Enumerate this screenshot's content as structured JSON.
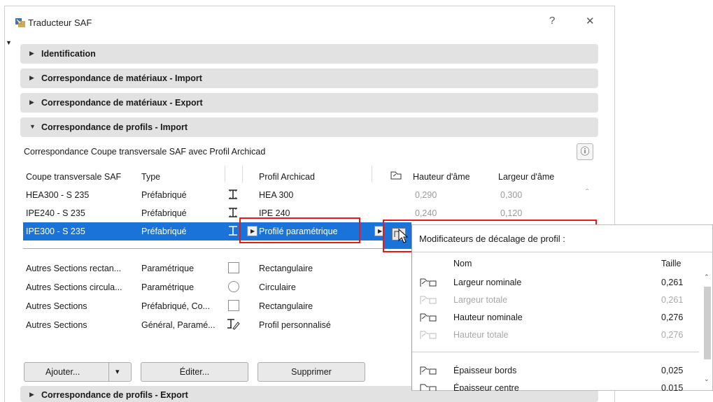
{
  "window": {
    "title": "Traducteur SAF",
    "help": "?",
    "close": "✕"
  },
  "sections": {
    "identification": "Identification",
    "mat_import": "Correspondance de matériaux - Import",
    "mat_export": "Correspondance de matériaux - Export",
    "prof_import": "Correspondance de profils - Import",
    "prof_export": "Correspondance de profils - Export"
  },
  "profile_import": {
    "caption": "Correspondance Coupe transversale SAF avec Profil Archicad",
    "info_icon": "ⓘ",
    "headers": {
      "saf": "Coupe transversale SAF",
      "type": "Type",
      "archicad": "Profil Archicad",
      "web_height": "Hauteur d'âme",
      "web_width": "Largeur d'âme"
    },
    "rows": [
      {
        "saf": "HEA300 - S 235",
        "type": "Préfabriqué",
        "icon": "i-beam-icon",
        "profile": "HEA 300",
        "height": "0,290",
        "width": "0,300"
      },
      {
        "saf": "IPE240 - S 235",
        "type": "Préfabriqué",
        "icon": "i-beam-icon",
        "profile": "IPE 240",
        "height": "0,240",
        "width": "0,120"
      },
      {
        "saf": "IPE300 - S 235",
        "type": "Préfabriqué",
        "icon": "i-beam-icon",
        "profile": "Profilé paramétrique",
        "height": "",
        "width": ""
      }
    ],
    "other_rows": [
      {
        "saf": "Autres Sections rectan...",
        "type": "Paramétrique",
        "icon": "square-icon",
        "profile": "Rectangulaire"
      },
      {
        "saf": "Autres Sections circula...",
        "type": "Paramétrique",
        "icon": "circle-icon",
        "profile": "Circulaire"
      },
      {
        "saf": "Autres Sections",
        "type": "Préfabriqué, Co...",
        "icon": "square-icon",
        "profile": "Rectangulaire"
      },
      {
        "saf": "Autres Sections",
        "type": "Général, Paramé...",
        "icon": "custom-profile-icon",
        "profile": "Profil personnalisé"
      }
    ],
    "buttons": {
      "add": "Ajouter...",
      "add_menu": "▾",
      "edit": "Éditer...",
      "delete": "Supprimer"
    }
  },
  "popup": {
    "title": "Modificateurs de décalage de profil :",
    "col_name": "Nom",
    "col_size": "Taille",
    "items": [
      {
        "name": "Largeur nominale",
        "value": "0,261",
        "enabled": true
      },
      {
        "name": "Largeur totale",
        "value": "0,261",
        "enabled": false
      },
      {
        "name": "Hauteur nominale",
        "value": "0,276",
        "enabled": true
      },
      {
        "name": "Hauteur totale",
        "value": "0,276",
        "enabled": false
      },
      {
        "name": "Épaisseur bords",
        "value": "0,025",
        "enabled": true
      },
      {
        "name": "Épaisseur centre",
        "value": "0,015",
        "enabled": true
      }
    ]
  },
  "colors": {
    "selection": "#1a73d9",
    "highlight_box": "#e31b1b",
    "section_bg": "#e2e2e2"
  }
}
